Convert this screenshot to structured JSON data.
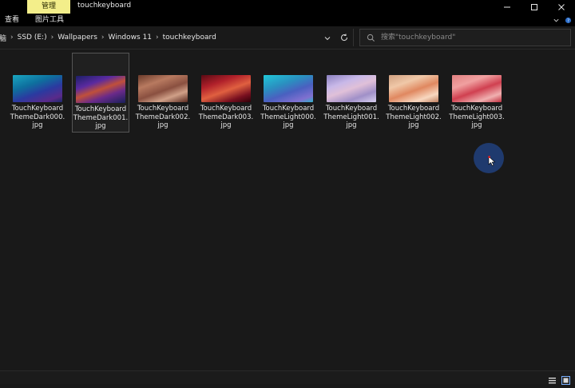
{
  "window": {
    "title": "touchkeyboard",
    "context_tab": "管理"
  },
  "ribbon": {
    "tabs": [
      "查看",
      "图片工具"
    ]
  },
  "address_bar": {
    "crumbs": [
      "电脑",
      "SSD (E:)",
      "Wallpapers",
      "Windows 11",
      "touchkeyboard"
    ]
  },
  "search": {
    "placeholder": "搜索\"touchkeyboard\""
  },
  "files": [
    {
      "name": "TouchKeyboardThemeDark000.jpg",
      "lines": [
        "TouchKeyboard",
        "ThemeDark000.",
        "jpg"
      ],
      "selected": false
    },
    {
      "name": "TouchKeyboardThemeDark001.jpg",
      "lines": [
        "TouchKeyboard",
        "ThemeDark001.",
        "jpg"
      ],
      "selected": true
    },
    {
      "name": "TouchKeyboardThemeDark002.jpg",
      "lines": [
        "TouchKeyboard",
        "ThemeDark002.",
        "jpg"
      ],
      "selected": false
    },
    {
      "name": "TouchKeyboardThemeDark003.jpg",
      "lines": [
        "TouchKeyboard",
        "ThemeDark003.",
        "jpg"
      ],
      "selected": false
    },
    {
      "name": "TouchKeyboardThemeLight000.jpg",
      "lines": [
        "TouchKeyboard",
        "ThemeLight000.",
        "jpg"
      ],
      "selected": false
    },
    {
      "name": "TouchKeyboardThemeLight001.jpg",
      "lines": [
        "TouchKeyboard",
        "ThemeLight001.",
        "jpg"
      ],
      "selected": false
    },
    {
      "name": "TouchKeyboardThemeLight002.jpg",
      "lines": [
        "TouchKeyboard",
        "ThemeLight002.",
        "jpg"
      ],
      "selected": false
    },
    {
      "name": "TouchKeyboardThemeLight003.jpg",
      "lines": [
        "TouchKeyboard",
        "ThemeLight003.",
        "jpg"
      ],
      "selected": false
    }
  ],
  "icons": {
    "minimize": "minimize-icon",
    "maximize": "maximize-icon",
    "close": "close-icon",
    "search": "search-icon",
    "refresh": "refresh-icon",
    "dropdown": "chevron-down-icon"
  },
  "colors": {
    "background": "#191919",
    "titlebar": "#000000",
    "context_tab": "#f3ee8a",
    "cursor_highlight": "#1f3a6e"
  }
}
